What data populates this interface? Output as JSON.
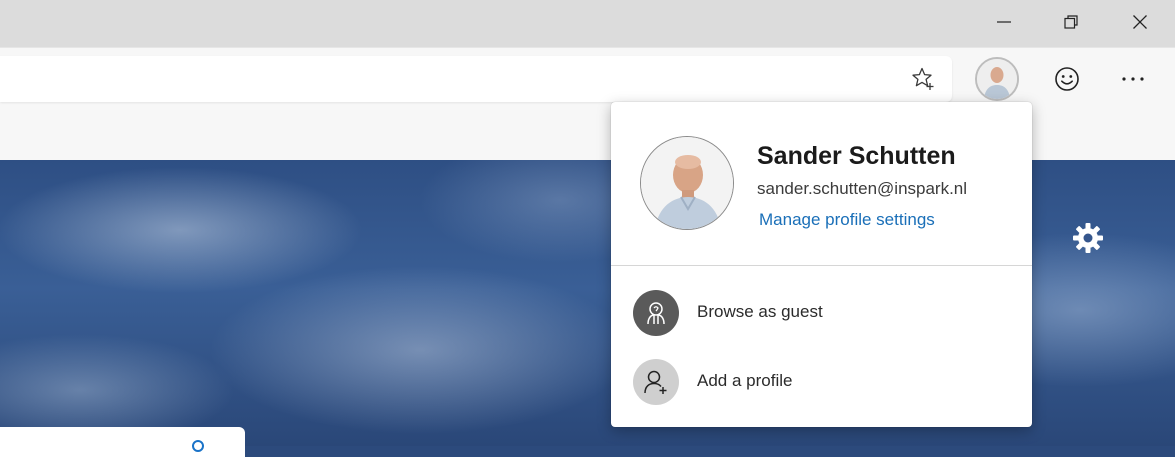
{
  "window": {
    "minimize_icon": "minimize-icon",
    "restore_icon": "restore-icon",
    "close_icon": "close-icon"
  },
  "toolbar": {
    "favorite_icon": "star-add-icon",
    "profile_icon": "profile-avatar",
    "feedback_icon": "smiley-icon",
    "more_icon": "ellipsis-icon"
  },
  "page": {
    "settings_icon": "gear-icon"
  },
  "profile_flyout": {
    "name": "Sander Schutten",
    "email": "sander.schutten@inspark.nl",
    "manage_link": "Manage profile settings",
    "items": [
      {
        "label": "Browse as guest",
        "icon": "guest-icon"
      },
      {
        "label": "Add a profile",
        "icon": "add-person-icon"
      }
    ]
  },
  "colors": {
    "link": "#1a6fb8",
    "titlebar": "#dcdcdc",
    "toolbar": "#f7f7f7",
    "guest_icon_bg": "#5a5a5a",
    "add_profile_icon_bg": "#cfcfcf"
  }
}
